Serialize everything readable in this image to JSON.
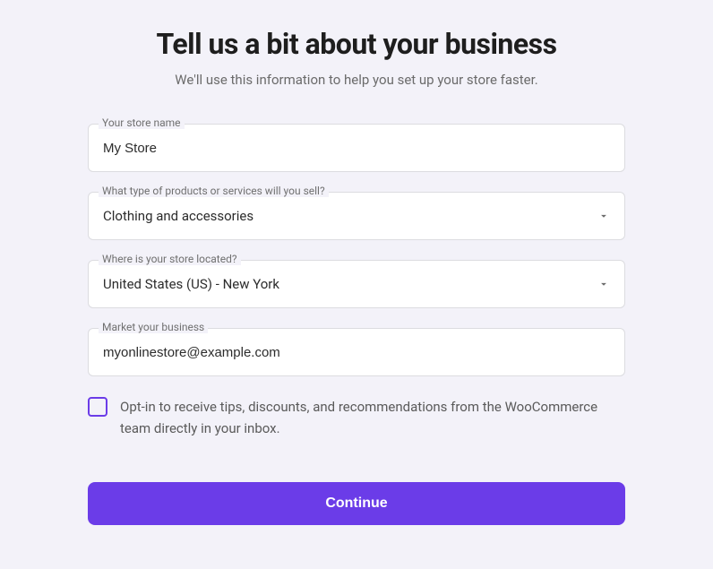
{
  "heading": "Tell us a bit about your business",
  "subtitle": "We'll use this information to help you set up your store faster.",
  "fields": {
    "store_name": {
      "label": "Your store name",
      "value": "My Store"
    },
    "product_type": {
      "label": "What type of products or services will you sell?",
      "value": "Clothing and accessories"
    },
    "location": {
      "label": "Where is your store located?",
      "value": "United States (US) - New York"
    },
    "email": {
      "label": "Market your business",
      "value": "myonlinestore@example.com"
    }
  },
  "optin": {
    "label": "Opt-in to receive tips, discounts, and recommendations from the WooCommerce team directly in your inbox."
  },
  "continue_button": "Continue"
}
